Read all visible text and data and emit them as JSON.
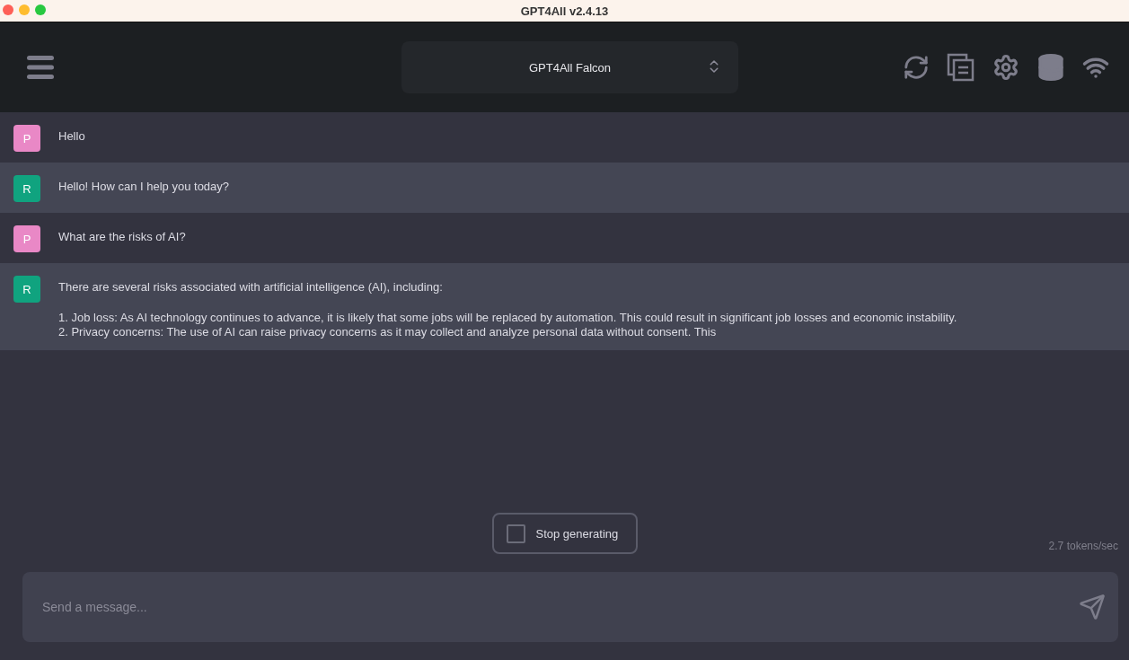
{
  "window": {
    "title": "GPT4All v2.4.13"
  },
  "model_selector": {
    "value": "GPT4All Falcon"
  },
  "messages": [
    {
      "kind": "prompt",
      "avatar": "P",
      "paragraphs": [
        [
          "Hello"
        ]
      ]
    },
    {
      "kind": "response",
      "avatar": "R",
      "paragraphs": [
        [
          "Hello! How can I help you today?"
        ]
      ]
    },
    {
      "kind": "prompt",
      "avatar": "P",
      "paragraphs": [
        [
          "What are the risks of AI?"
        ]
      ]
    },
    {
      "kind": "response",
      "avatar": "R",
      "paragraphs": [
        [
          "There are several risks associated with artificial intelligence (AI), including:"
        ],
        [
          "1. Job loss: As AI technology continues to advance, it is likely that some jobs will be replaced by automation. This could result in significant job losses and economic instability.",
          "2. Privacy concerns: The use of AI can raise privacy concerns as it may collect and analyze personal data without consent. This"
        ]
      ]
    }
  ],
  "stop_button": {
    "label": "Stop generating"
  },
  "speed": "2.7 tokens/sec",
  "input": {
    "placeholder": "Send a message..."
  }
}
